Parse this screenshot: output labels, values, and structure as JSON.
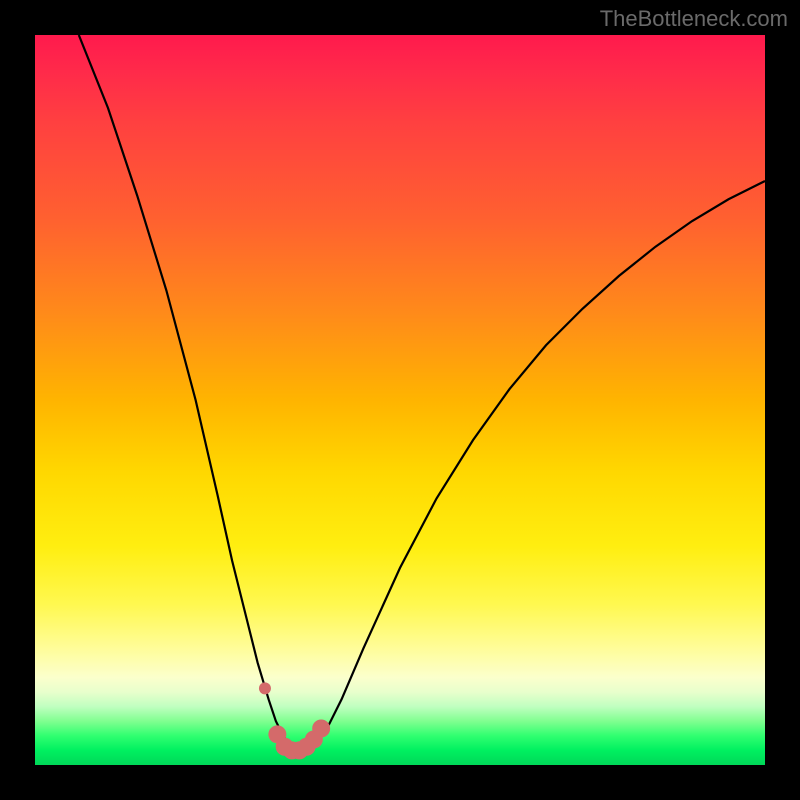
{
  "watermark": "TheBottleneck.com",
  "colors": {
    "curve_stroke": "#000000",
    "marker_fill": "#d46a6a",
    "background": "#000000",
    "gradient_top": "#ff1a4d",
    "gradient_mid": "#ffee10",
    "gradient_bottom": "#00d858"
  },
  "chart_data": {
    "type": "line",
    "title": "",
    "xlabel": "",
    "ylabel": "",
    "xlim": [
      0,
      100
    ],
    "ylim": [
      0,
      100
    ],
    "grid": false,
    "series": [
      {
        "name": "bottleneck-curve",
        "x": [
          6,
          10,
          14,
          18,
          22,
          25,
          27,
          29,
          30.5,
          32,
          33,
          34,
          35,
          36,
          37,
          38,
          39,
          40,
          42,
          45,
          50,
          55,
          60,
          65,
          70,
          75,
          80,
          85,
          90,
          95,
          100
        ],
        "y": [
          100,
          90,
          78,
          65,
          50,
          37,
          28,
          20,
          14,
          9,
          6,
          4,
          2.5,
          2,
          2,
          2.5,
          3.5,
          5,
          9,
          16,
          27,
          36.5,
          44.5,
          51.5,
          57.5,
          62.5,
          67,
          71,
          74.5,
          77.5,
          80
        ]
      }
    ],
    "markers": {
      "name": "optimal-range",
      "x": [
        31.5,
        33.2,
        34.2,
        35.2,
        36.2,
        37.2,
        38.2,
        39.2
      ],
      "y": [
        10.5,
        4.2,
        2.5,
        2,
        2,
        2.5,
        3.5,
        5
      ],
      "r_first": 6,
      "r_rest": 9
    }
  }
}
